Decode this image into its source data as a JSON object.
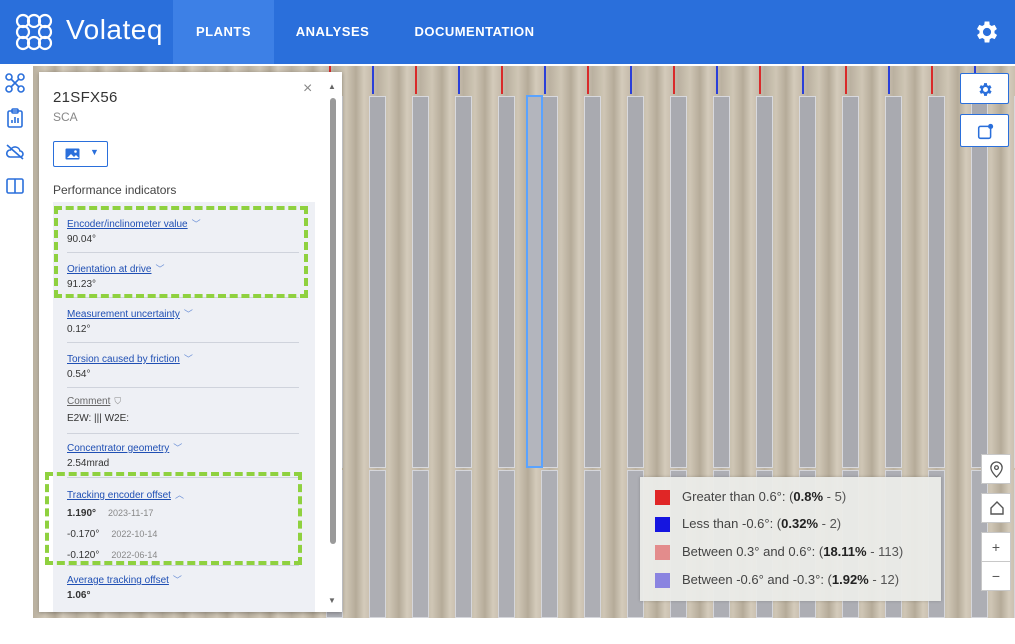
{
  "app": {
    "brand": "Volateq",
    "nav": [
      {
        "label": "PLANTS",
        "active": true
      },
      {
        "label": "ANALYSES",
        "active": false
      },
      {
        "label": "DOCUMENTATION",
        "active": false
      }
    ],
    "accent": "#2a6fdb"
  },
  "panel": {
    "title": "21SFX56",
    "subtitle": "SCA",
    "close_glyph": "×",
    "section_title": "Performance indicators",
    "items": [
      {
        "label": "Encoder/inclinometer value",
        "value": "90.04°"
      },
      {
        "label": "Orientation at drive",
        "value": "91.23°"
      },
      {
        "label": "Measurement uncertainty",
        "value": "0.12°"
      },
      {
        "label": "Torsion caused by friction",
        "value": "0.54°"
      },
      {
        "label": "Comment",
        "value": "E2W: ||| W2E:"
      },
      {
        "label": "Concentrator geometry",
        "value": "2.54mrad"
      },
      {
        "label": "Tracking encoder offset",
        "history": [
          {
            "value": "1.190°",
            "date": "2023-11-17"
          },
          {
            "value": "-0.170°",
            "date": "2022-10-14"
          },
          {
            "value": "-0.120°",
            "date": "2022-06-14"
          }
        ]
      },
      {
        "label": "Average tracking offset",
        "value": "1.06°"
      }
    ]
  },
  "map_controls": {
    "zoom_in": "+",
    "zoom_out": "−"
  },
  "legend": [
    {
      "color": "#e02626",
      "text": "Greater than 0.6°: (",
      "pct": "0.8%",
      "count": " - 5)"
    },
    {
      "color": "#1515e0",
      "text": "Less than -0.6°: (",
      "pct": "0.32%",
      "count": " - 2)"
    },
    {
      "color": "#e38c8c",
      "text": "Between 0.3° and 0.6°: (",
      "pct": "18.11%",
      "count": " - 113)"
    },
    {
      "color": "#8a84e0",
      "text": "Between -0.6° and -0.3°: (",
      "pct": "1.92%",
      "count": " - 12)"
    }
  ],
  "colors": {
    "row_red": "#c97778",
    "row_blue": "#6f6bd0",
    "row_gray": "#a9aab0"
  }
}
